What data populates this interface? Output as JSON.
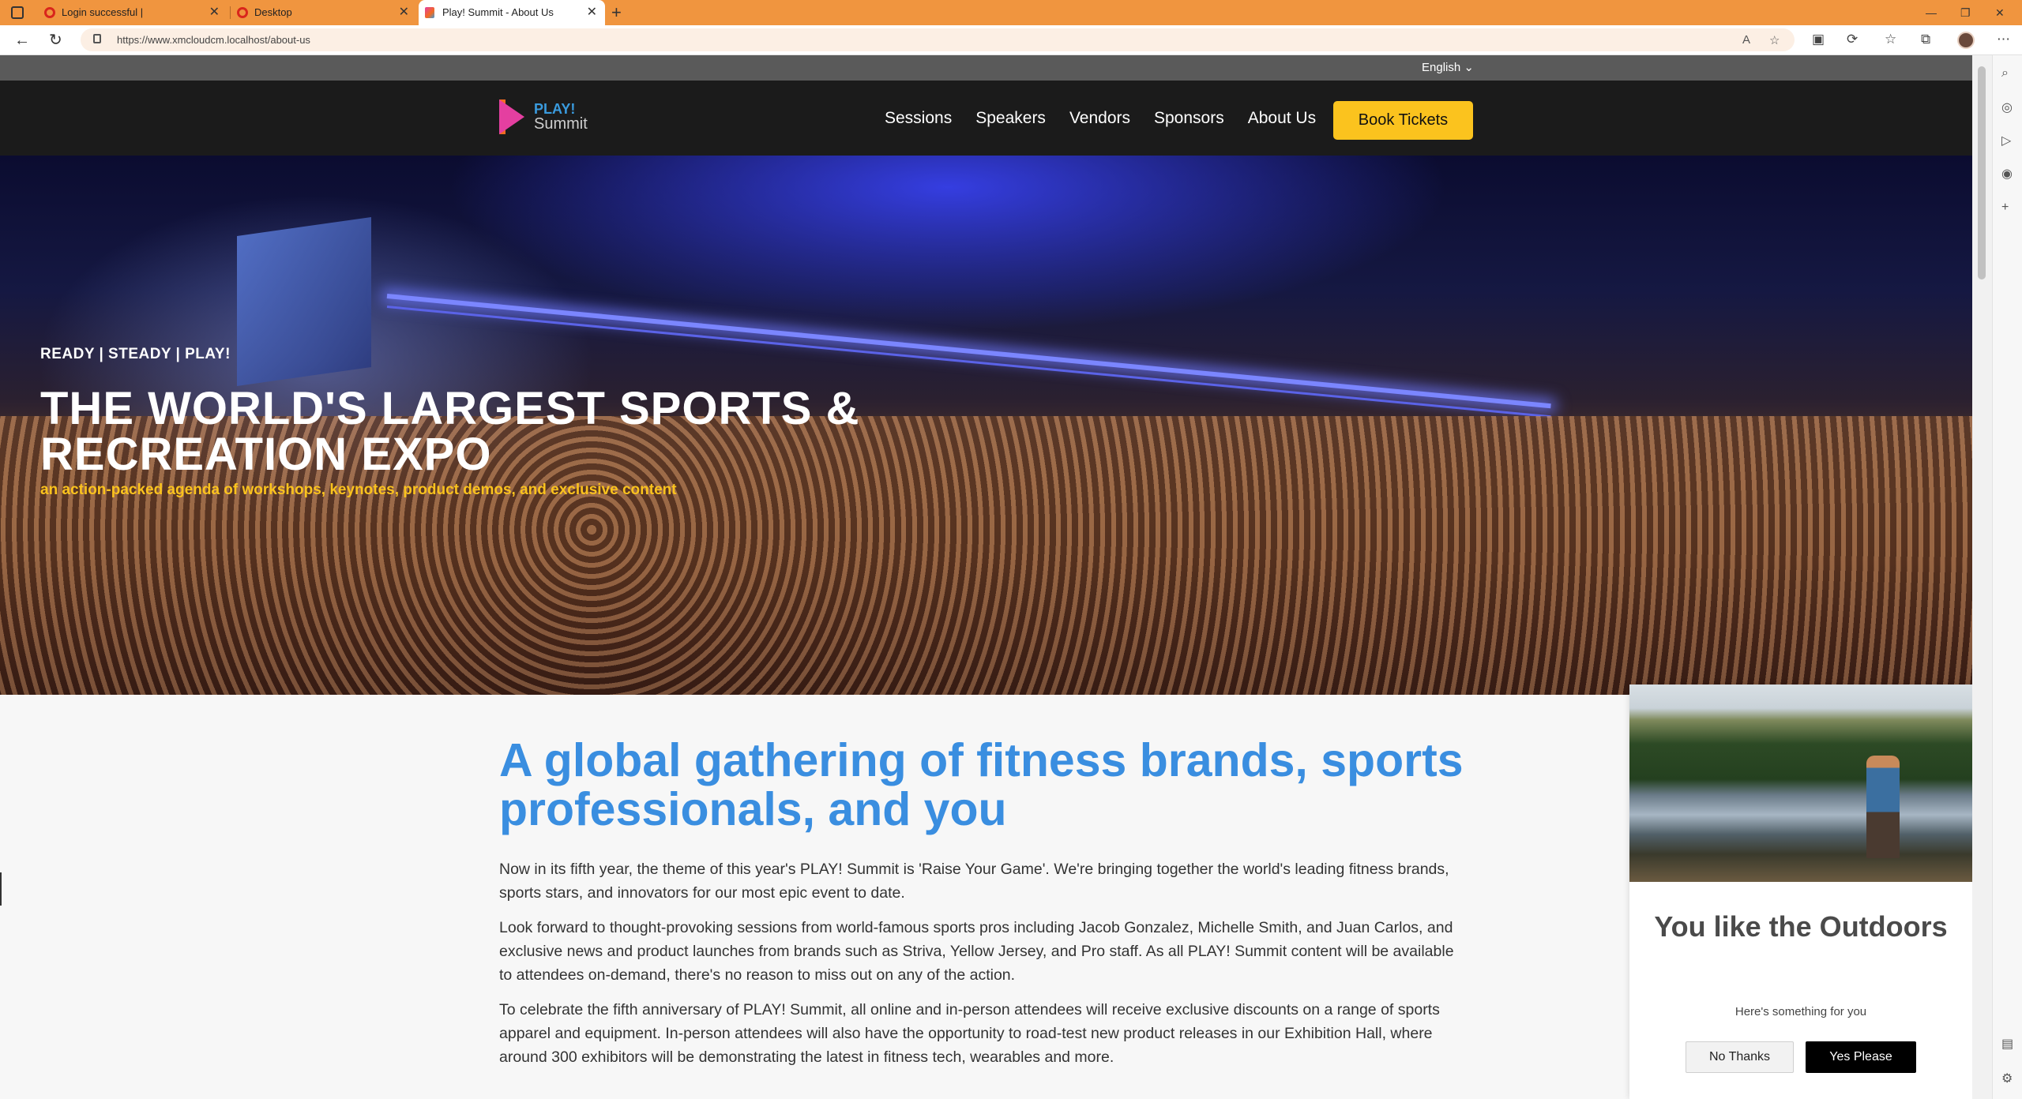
{
  "browser": {
    "tabs": [
      {
        "label": "Login successful |",
        "active": false
      },
      {
        "label": "Desktop",
        "active": false
      },
      {
        "label": "Play! Summit - About Us",
        "active": true
      }
    ],
    "url": "https://www.xmcloudcm.localhost/about-us",
    "icons": [
      "back-icon",
      "refresh-icon",
      "lock-icon",
      "read-aloud-icon",
      "favorites-add-icon",
      "split-screen-icon",
      "extensions-icon",
      "favorites-icon",
      "collections-icon",
      "profile-avatar",
      "more-icon"
    ],
    "sidebar_icons": [
      "search-icon",
      "copilot-icon",
      "games-icon",
      "office-icon",
      "add-icon",
      "feedback-icon",
      "settings-icon"
    ]
  },
  "page": {
    "language": "English ⌄",
    "logo": {
      "line1": "PLAY!",
      "line2": "Summit"
    },
    "nav": [
      "Sessions",
      "Speakers",
      "Vendors",
      "Sponsors",
      "About Us"
    ],
    "cta": "Book Tickets",
    "hero": {
      "tagline": "READY | STEADY | PLAY!",
      "title": "THE WORLD'S LARGEST SPORTS & RECREATION EXPO",
      "subtitle": "an action-packed agenda of workshops, keynotes, product demos, and exclusive content"
    },
    "content": {
      "heading": "A global gathering of fitness brands, sports professionals, and you",
      "paragraphs": [
        "Now in its fifth year, the theme of this year's PLAY! Summit is 'Raise Your Game'. We're bringing together the world's leading fitness brands, sports stars, and innovators for our most epic event to date.",
        "Look forward to thought-provoking sessions from world-famous sports pros including Jacob Gonzalez, Michelle Smith, and Juan Carlos, and exclusive news and product launches from brands such as Striva, Yellow Jersey, and Pro staff. As all PLAY! Summit content will be available to attendees on-demand, there's no reason to miss out on any of the action.",
        "To celebrate the fifth anniversary of PLAY! Summit, all online and in-person attendees will receive exclusive discounts on a range of sports apparel and equipment. In-person attendees will also have the opportunity to road-test new product releases in our Exhibition Hall, where around 300 exhibitors will be demonstrating the latest in fitness tech, wearables and more."
      ]
    },
    "popup": {
      "title": "You like the Outdoors",
      "message": "Here's something for you",
      "no_label": "No Thanks",
      "yes_label": "Yes Please"
    }
  },
  "colors": {
    "accent_blue": "#3a8ee0",
    "cta_yellow": "#fbc31e",
    "header_bg": "#1b1b1b",
    "tabbar": "#f0953f"
  }
}
